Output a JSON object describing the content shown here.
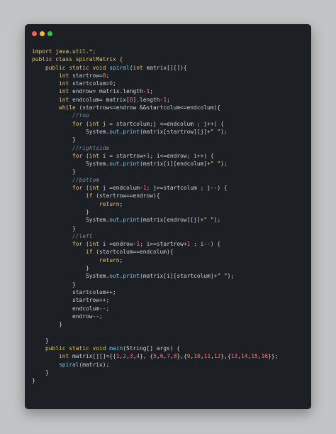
{
  "window_controls": [
    {
      "name": "close",
      "color": "#ff5f57"
    },
    {
      "name": "minimize",
      "color": "#febc2e"
    },
    {
      "name": "maximize",
      "color": "#28c840"
    }
  ],
  "code_lines": [
    [
      {
        "t": "import java.util.*;",
        "c": "kw"
      }
    ],
    [
      {
        "t": "public class spiralMatrix {",
        "c": "kw"
      }
    ],
    [
      {
        "t": "    public static void ",
        "c": "kw"
      },
      {
        "t": "spiral",
        "c": "fn"
      },
      {
        "t": "(",
        "c": "op"
      },
      {
        "t": "int",
        "c": "kw"
      },
      {
        "t": " matrix[][]){",
        "c": "id"
      }
    ],
    [
      {
        "t": "        int",
        "c": "kw"
      },
      {
        "t": " startrow=",
        "c": "id"
      },
      {
        "t": "0",
        "c": "num"
      },
      {
        "t": ";",
        "c": "op"
      }
    ],
    [
      {
        "t": "        int",
        "c": "kw"
      },
      {
        "t": " startcolum=",
        "c": "id"
      },
      {
        "t": "0",
        "c": "num"
      },
      {
        "t": ";",
        "c": "op"
      }
    ],
    [
      {
        "t": "        int",
        "c": "kw"
      },
      {
        "t": " endrow= matrix.length-",
        "c": "id"
      },
      {
        "t": "1",
        "c": "num"
      },
      {
        "t": ";",
        "c": "op"
      }
    ],
    [
      {
        "t": "        int",
        "c": "kw"
      },
      {
        "t": " endcolum= matrix[",
        "c": "id"
      },
      {
        "t": "0",
        "c": "num"
      },
      {
        "t": "].length-",
        "c": "id"
      },
      {
        "t": "1",
        "c": "num"
      },
      {
        "t": ";",
        "c": "op"
      }
    ],
    [
      {
        "t": "        while",
        "c": "kw"
      },
      {
        "t": " (startrow<=endrow &&startcolum<=endcolum){",
        "c": "id"
      }
    ],
    [
      {
        "t": "            //top",
        "c": "cm"
      }
    ],
    [
      {
        "t": "            for",
        "c": "kw"
      },
      {
        "t": " (",
        "c": "op"
      },
      {
        "t": "int",
        "c": "kw"
      },
      {
        "t": " j = startcolum;j <=endcolum ; j++) {",
        "c": "id"
      }
    ],
    [
      {
        "t": "                System.",
        "c": "id"
      },
      {
        "t": "out",
        "c": "fn"
      },
      {
        "t": ".",
        "c": "op"
      },
      {
        "t": "print",
        "c": "fn"
      },
      {
        "t": "(matrix[startrow][j]+",
        "c": "id"
      },
      {
        "t": "\" \"",
        "c": "str"
      },
      {
        "t": ");",
        "c": "op"
      }
    ],
    [
      {
        "t": "            }",
        "c": "op"
      }
    ],
    [
      {
        "t": "            //rightside",
        "c": "cm"
      }
    ],
    [
      {
        "t": "            for",
        "c": "kw"
      },
      {
        "t": " (",
        "c": "op"
      },
      {
        "t": "int",
        "c": "kw"
      },
      {
        "t": " i = startrow+",
        "c": "id"
      },
      {
        "t": "1",
        "c": "num"
      },
      {
        "t": "; i<=endrow; i++) {",
        "c": "id"
      }
    ],
    [
      {
        "t": "                System.",
        "c": "id"
      },
      {
        "t": "out",
        "c": "fn"
      },
      {
        "t": ".",
        "c": "op"
      },
      {
        "t": "print",
        "c": "fn"
      },
      {
        "t": "(matrix[i][endcolum]+",
        "c": "id"
      },
      {
        "t": "\" \"",
        "c": "str"
      },
      {
        "t": ");",
        "c": "op"
      }
    ],
    [
      {
        "t": "            }",
        "c": "op"
      }
    ],
    [
      {
        "t": "            //bottom",
        "c": "cm"
      }
    ],
    [
      {
        "t": "            for",
        "c": "kw"
      },
      {
        "t": " (",
        "c": "op"
      },
      {
        "t": "int",
        "c": "kw"
      },
      {
        "t": " j =endcolum-",
        "c": "id"
      },
      {
        "t": "1",
        "c": "num"
      },
      {
        "t": "; j>=startcolum ; j--) {",
        "c": "id"
      }
    ],
    [
      {
        "t": "                if",
        "c": "kw"
      },
      {
        "t": " (startrow==endrow){",
        "c": "id"
      }
    ],
    [
      {
        "t": "                    return",
        "c": "kw"
      },
      {
        "t": ";",
        "c": "op"
      }
    ],
    [
      {
        "t": "                }",
        "c": "op"
      }
    ],
    [
      {
        "t": "                System.",
        "c": "id"
      },
      {
        "t": "out",
        "c": "fn"
      },
      {
        "t": ".",
        "c": "op"
      },
      {
        "t": "print",
        "c": "fn"
      },
      {
        "t": "(matrix[endrow][j]+",
        "c": "id"
      },
      {
        "t": "\" \"",
        "c": "str"
      },
      {
        "t": ");",
        "c": "op"
      }
    ],
    [
      {
        "t": "            }",
        "c": "op"
      }
    ],
    [
      {
        "t": "            //left",
        "c": "cm"
      }
    ],
    [
      {
        "t": "            for",
        "c": "kw"
      },
      {
        "t": " (",
        "c": "op"
      },
      {
        "t": "int",
        "c": "kw"
      },
      {
        "t": " i =endrow-",
        "c": "id"
      },
      {
        "t": "1",
        "c": "num"
      },
      {
        "t": "; i>=startrow+",
        "c": "id"
      },
      {
        "t": "1",
        "c": "num"
      },
      {
        "t": " ; i--) {",
        "c": "id"
      }
    ],
    [
      {
        "t": "                if",
        "c": "kw"
      },
      {
        "t": " (startcolum==endcolum){",
        "c": "id"
      }
    ],
    [
      {
        "t": "                    return",
        "c": "kw"
      },
      {
        "t": ";",
        "c": "op"
      }
    ],
    [
      {
        "t": "                }",
        "c": "op"
      }
    ],
    [
      {
        "t": "                System.",
        "c": "id"
      },
      {
        "t": "out",
        "c": "fn"
      },
      {
        "t": ".",
        "c": "op"
      },
      {
        "t": "print",
        "c": "fn"
      },
      {
        "t": "(matrix[i][startcolum]+",
        "c": "id"
      },
      {
        "t": "\" \"",
        "c": "str"
      },
      {
        "t": ");",
        "c": "op"
      }
    ],
    [
      {
        "t": "            }",
        "c": "op"
      }
    ],
    [
      {
        "t": "            startcolum++;",
        "c": "id"
      }
    ],
    [
      {
        "t": "            startrow++;",
        "c": "id"
      }
    ],
    [
      {
        "t": "            endcolum--;",
        "c": "id"
      }
    ],
    [
      {
        "t": "            endrow--;",
        "c": "id"
      }
    ],
    [
      {
        "t": "        }",
        "c": "op"
      }
    ],
    [
      {
        "t": "",
        "c": "op"
      }
    ],
    [
      {
        "t": "    }",
        "c": "op"
      }
    ],
    [
      {
        "t": "    public static void ",
        "c": "kw"
      },
      {
        "t": "main",
        "c": "fn"
      },
      {
        "t": "(String[] args) {",
        "c": "id"
      }
    ],
    [
      {
        "t": "        int",
        "c": "kw"
      },
      {
        "t": " matrix[][]={{",
        "c": "id"
      },
      {
        "t": "1",
        "c": "num"
      },
      {
        "t": ",",
        "c": "op"
      },
      {
        "t": "2",
        "c": "num"
      },
      {
        "t": ",",
        "c": "op"
      },
      {
        "t": "3",
        "c": "num"
      },
      {
        "t": ",",
        "c": "op"
      },
      {
        "t": "4",
        "c": "num"
      },
      {
        "t": "}, {",
        "c": "op"
      },
      {
        "t": "5",
        "c": "num"
      },
      {
        "t": ",",
        "c": "op"
      },
      {
        "t": "6",
        "c": "num"
      },
      {
        "t": ",",
        "c": "op"
      },
      {
        "t": "7",
        "c": "num"
      },
      {
        "t": ",",
        "c": "op"
      },
      {
        "t": "8",
        "c": "num"
      },
      {
        "t": "},{",
        "c": "op"
      },
      {
        "t": "9",
        "c": "num"
      },
      {
        "t": ",",
        "c": "op"
      },
      {
        "t": "10",
        "c": "num"
      },
      {
        "t": ",",
        "c": "op"
      },
      {
        "t": "11",
        "c": "num"
      },
      {
        "t": ",",
        "c": "op"
      },
      {
        "t": "12",
        "c": "num"
      },
      {
        "t": "},{",
        "c": "op"
      },
      {
        "t": "13",
        "c": "num"
      },
      {
        "t": ",",
        "c": "op"
      },
      {
        "t": "14",
        "c": "num"
      },
      {
        "t": ",",
        "c": "op"
      },
      {
        "t": "15",
        "c": "num"
      },
      {
        "t": ",",
        "c": "op"
      },
      {
        "t": "16",
        "c": "num"
      },
      {
        "t": "}};",
        "c": "op"
      }
    ],
    [
      {
        "t": "        spiral",
        "c": "fn"
      },
      {
        "t": "(matrix);",
        "c": "id"
      }
    ],
    [
      {
        "t": "    }",
        "c": "op"
      }
    ],
    [
      {
        "t": "}",
        "c": "op"
      }
    ]
  ]
}
